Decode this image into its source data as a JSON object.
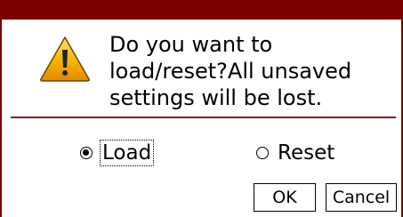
{
  "dialog": {
    "icon": "warning-icon",
    "message_lines": [
      "Do you want to",
      "load/reset?All unsaved",
      "settings will be lost."
    ],
    "options": [
      {
        "label": "Load",
        "selected": true
      },
      {
        "label": "Reset",
        "selected": false
      }
    ],
    "ok_label": "OK",
    "cancel_label": "Cancel"
  },
  "colors": {
    "titlebar": "#7b0000",
    "divider": "#8b1a1a",
    "icon_fill": "#f5b500"
  }
}
